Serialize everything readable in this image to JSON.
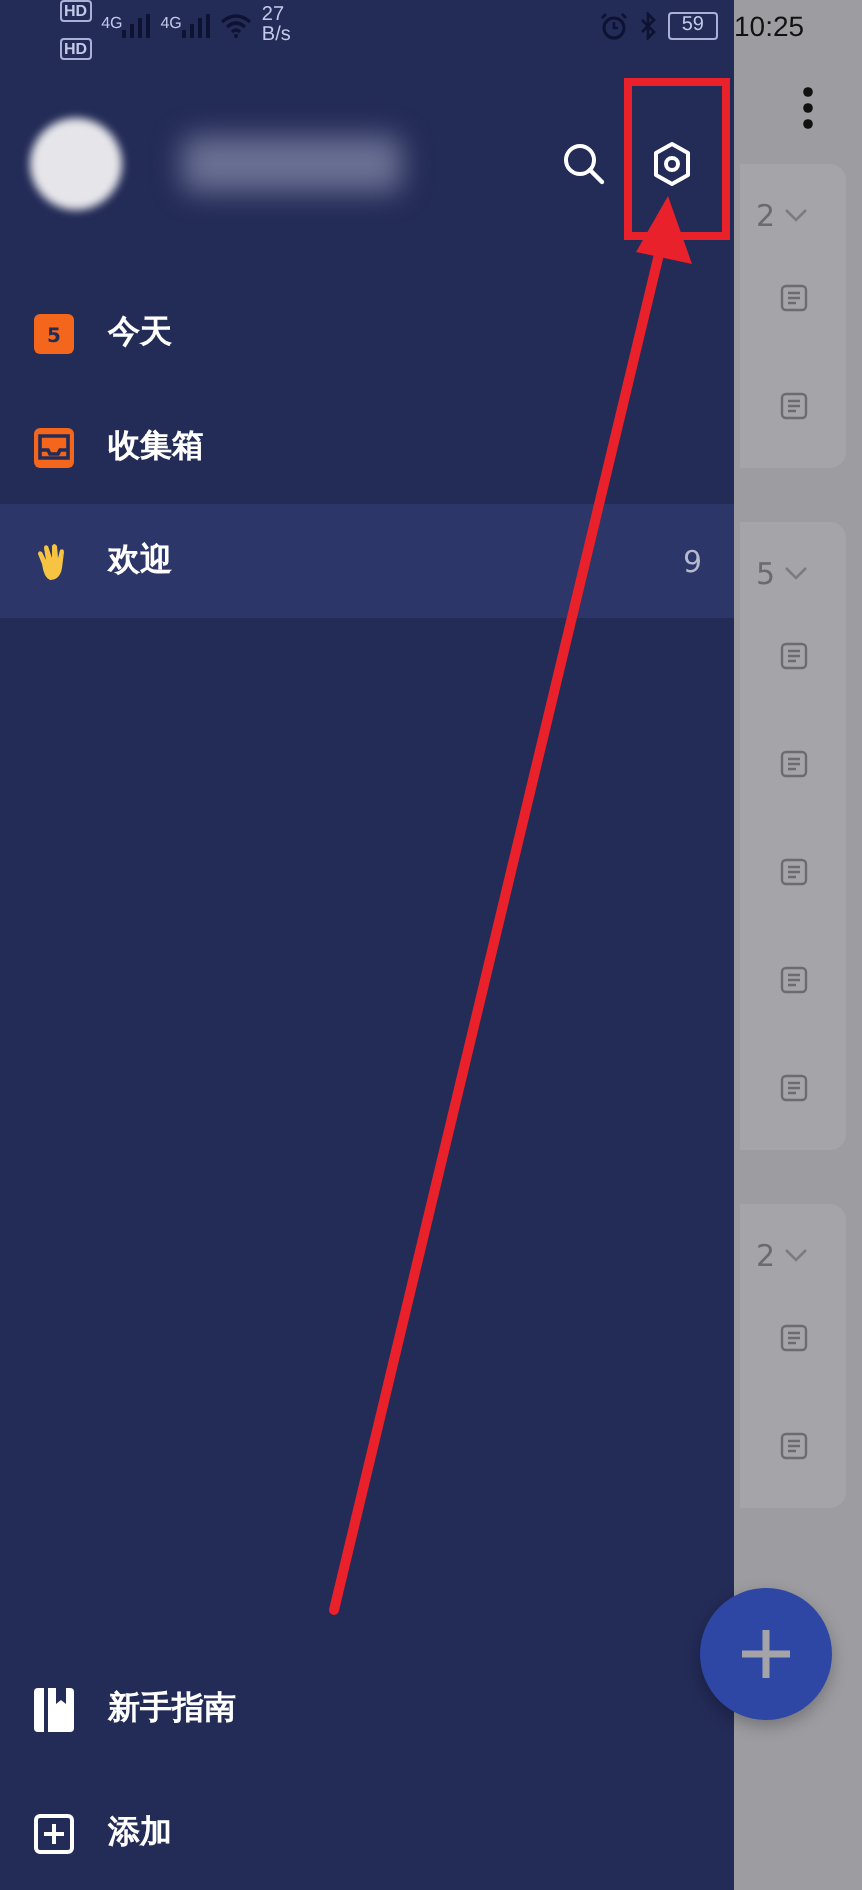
{
  "status_bar": {
    "hd_labels": [
      "HD",
      "HD"
    ],
    "network_types": [
      "4G",
      "4G"
    ],
    "network_speed": "27",
    "speed_unit": "B/s",
    "battery": "59",
    "time": "10:25"
  },
  "drawer": {
    "items": [
      {
        "kind": "today",
        "label": "今天",
        "icon_text": "5",
        "selected": false
      },
      {
        "kind": "inbox",
        "label": "收集箱",
        "selected": false
      },
      {
        "kind": "welcome",
        "label": "欢迎",
        "count": "9",
        "selected": true
      }
    ],
    "footer": [
      {
        "kind": "guide",
        "label": "新手指南"
      },
      {
        "kind": "add",
        "label": "添加"
      }
    ]
  },
  "groups": [
    {
      "count": "2",
      "notes": [
        {
          "kind": "note"
        },
        {
          "kind": "note"
        }
      ]
    },
    {
      "count": "5",
      "notes": [
        {
          "kind": "note"
        },
        {
          "kind": "note"
        },
        {
          "kind": "note"
        },
        {
          "kind": "note"
        },
        {
          "kind": "note"
        }
      ]
    },
    {
      "count": "2",
      "notes": [
        {
          "kind": "note"
        },
        {
          "kind": "note"
        }
      ]
    }
  ]
}
